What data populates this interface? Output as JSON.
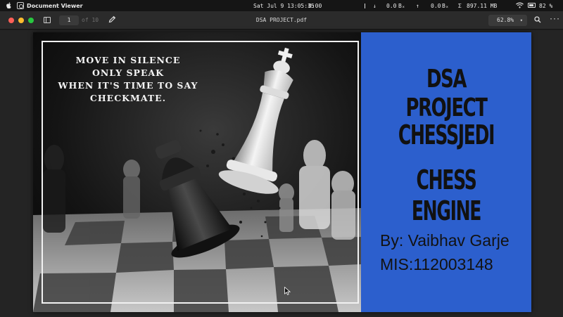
{
  "menubar": {
    "apple_icon": "apple-logo-icon",
    "app_icon": "document-viewer-icon",
    "app_name": "Document Viewer",
    "datetime": "Sat Jul 9 13:05:35",
    "net_time": "0:00",
    "down_value": "0.0",
    "down_unit": "Bₓ",
    "up_value": "0.0",
    "up_unit": "Bₓ",
    "sigma": "Σ",
    "memory": "897.11 MB",
    "battery": "82 %"
  },
  "toolbar": {
    "page_current": "1",
    "page_of": "of 10",
    "document_title": "DSA PROJECT.pdf",
    "zoom": "62.8%",
    "zoom_chevron": "▾",
    "more": "···"
  },
  "slide": {
    "quote": "MOVE IN SILENCE\nONLY SPEAK\nWHEN IT'S TIME TO SAY\nCHECKMATE.",
    "title_line1": "DSA PROJECT",
    "title_line2": "CHESSJEDI",
    "title_line3": "CHESS ENGINE",
    "author": "By: Vaibhav Garje",
    "mis": "MIS:112003148",
    "panel_color": "#2c5fcd"
  }
}
